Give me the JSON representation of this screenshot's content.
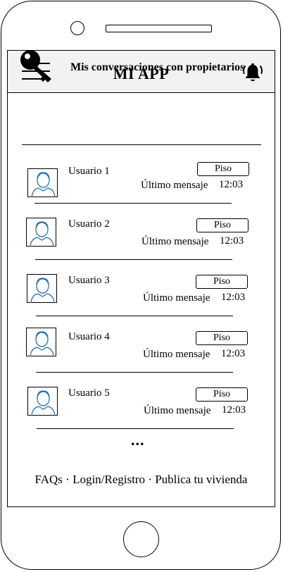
{
  "header": {
    "title": "MI APP",
    "menu_icon": "hamburger-menu-icon",
    "bell_icon": "notification-bell-icon"
  },
  "section": {
    "icon": "key-icon",
    "title": "Mis conversaciones con propietarios"
  },
  "conversations": [
    {
      "user": "Usuario 1",
      "tag": "Piso",
      "last_message": "Último mensaje",
      "time": "12:03"
    },
    {
      "user": "Usuario 2",
      "tag": "Piso",
      "last_message": "Último mensaje",
      "time": "12:03"
    },
    {
      "user": "Usuario 3",
      "tag": "Piso",
      "last_message": "Último mensaje",
      "time": "12:03"
    },
    {
      "user": "Usuario 4",
      "tag": "Piso",
      "last_message": "Último mensaje",
      "time": "12:03"
    },
    {
      "user": "Usuario 5",
      "tag": "Piso",
      "last_message": "Último mensaje",
      "time": "12:03"
    }
  ],
  "more_label": "...",
  "footer": {
    "faqs": "FAQs",
    "sep1": " · ",
    "login": "Login/Registro",
    "sep2": " · ",
    "publish": "Publica tu vivienda"
  }
}
